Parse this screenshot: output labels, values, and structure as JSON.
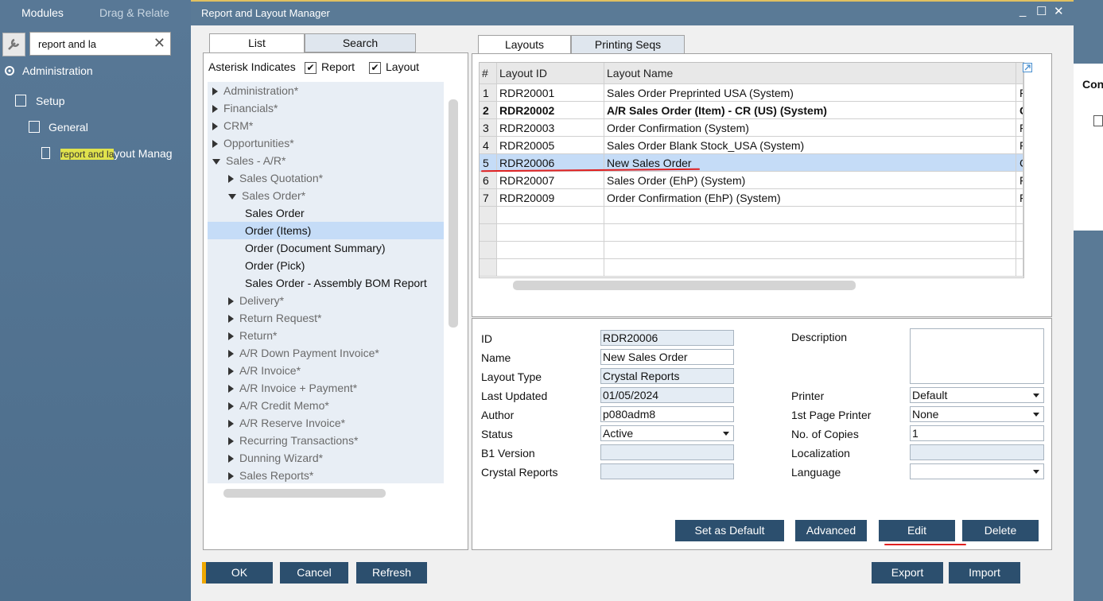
{
  "left_panel": {
    "tabs": [
      "Modules",
      "Drag & Relate"
    ],
    "search_value": "report and la",
    "tree": {
      "administration": "Administration",
      "setup": "Setup",
      "general": "General",
      "item_highlight": "report and la",
      "item_rest": "yout Manag"
    }
  },
  "right_strip": {
    "label": "Con"
  },
  "window": {
    "title": "Report and Layout Manager",
    "controls": [
      "_",
      "☐",
      "✕"
    ]
  },
  "left_tabs": {
    "list": "List",
    "search": "Search"
  },
  "asterisk": {
    "label": "Asterisk Indicates",
    "report": "Report",
    "layout": "Layout",
    "report_checked": true,
    "layout_checked": true
  },
  "tree_items": [
    {
      "label": "Administration*",
      "kind": "cat",
      "level": 0,
      "icon": "collapsed"
    },
    {
      "label": "Financials*",
      "kind": "cat",
      "level": 0,
      "icon": "collapsed"
    },
    {
      "label": "CRM*",
      "kind": "cat",
      "level": 0,
      "icon": "collapsed"
    },
    {
      "label": "Opportunities*",
      "kind": "cat",
      "level": 0,
      "icon": "collapsed"
    },
    {
      "label": "Sales - A/R*",
      "kind": "cat",
      "level": 0,
      "icon": "expanded"
    },
    {
      "label": "Sales Quotation*",
      "kind": "cat",
      "level": 1,
      "icon": "collapsed"
    },
    {
      "label": "Sales Order*",
      "kind": "cat",
      "level": 1,
      "icon": "expanded"
    },
    {
      "label": "Sales Order",
      "kind": "doc",
      "level": 2,
      "icon": "none"
    },
    {
      "label": "Order (Items)",
      "kind": "doc",
      "level": 2,
      "icon": "none",
      "selected": true
    },
    {
      "label": "Order (Document Summary)",
      "kind": "doc",
      "level": 2,
      "icon": "none"
    },
    {
      "label": "Order (Pick)",
      "kind": "doc",
      "level": 2,
      "icon": "none"
    },
    {
      "label": "Sales Order - Assembly BOM Report",
      "kind": "doc",
      "level": 2,
      "icon": "none"
    },
    {
      "label": "Delivery*",
      "kind": "cat",
      "level": 1,
      "icon": "collapsed"
    },
    {
      "label": "Return Request*",
      "kind": "cat",
      "level": 1,
      "icon": "collapsed"
    },
    {
      "label": "Return*",
      "kind": "cat",
      "level": 1,
      "icon": "collapsed"
    },
    {
      "label": "A/R Down Payment Invoice*",
      "kind": "cat",
      "level": 1,
      "icon": "collapsed"
    },
    {
      "label": "A/R Invoice*",
      "kind": "cat",
      "level": 1,
      "icon": "collapsed"
    },
    {
      "label": "A/R Invoice + Payment*",
      "kind": "cat",
      "level": 1,
      "icon": "collapsed"
    },
    {
      "label": "A/R Credit Memo*",
      "kind": "cat",
      "level": 1,
      "icon": "collapsed"
    },
    {
      "label": "A/R Reserve Invoice*",
      "kind": "cat",
      "level": 1,
      "icon": "collapsed"
    },
    {
      "label": "Recurring Transactions*",
      "kind": "cat",
      "level": 1,
      "icon": "collapsed"
    },
    {
      "label": "Dunning Wizard*",
      "kind": "cat",
      "level": 1,
      "icon": "collapsed"
    },
    {
      "label": "Sales Reports*",
      "kind": "cat",
      "level": 1,
      "icon": "collapsed"
    }
  ],
  "right_tabs": {
    "layouts": "Layouts",
    "printing": "Printing Seqs"
  },
  "grid": {
    "headers": [
      "#",
      "Layout ID",
      "Layout Name"
    ],
    "rows": [
      {
        "num": "1",
        "id": "RDR20001",
        "name": "Sales Order Preprinted USA (System)",
        "extra": "F"
      },
      {
        "num": "2",
        "id": "RDR20002",
        "name": "A/R Sales Order (Item) - CR (US) (System)",
        "extra": "C",
        "bold": true
      },
      {
        "num": "3",
        "id": "RDR20003",
        "name": "Order Confirmation (System)",
        "extra": "F"
      },
      {
        "num": "4",
        "id": "RDR20005",
        "name": "Sales Order Blank Stock_USA (System)",
        "extra": "F"
      },
      {
        "num": "5",
        "id": "RDR20006",
        "name": "New Sales Order",
        "extra": "C",
        "selected": true
      },
      {
        "num": "6",
        "id": "RDR20007",
        "name": "Sales Order (EhP) (System)",
        "extra": "F"
      },
      {
        "num": "7",
        "id": "RDR20009",
        "name": "Order Confirmation (EhP) (System)",
        "extra": "F"
      }
    ]
  },
  "form": {
    "id_label": "ID",
    "id_value": "RDR20006",
    "name_label": "Name",
    "name_value": "New Sales Order",
    "type_label": "Layout Type",
    "type_value": "Crystal Reports",
    "updated_label": "Last Updated",
    "updated_value": "01/05/2024",
    "author_label": "Author",
    "author_value": "p080adm8",
    "status_label": "Status",
    "status_value": "Active",
    "b1_label": "B1 Version",
    "b1_value": "",
    "crystal_label": "Crystal Reports",
    "crystal_value": "",
    "description_label": "Description",
    "description_value": "",
    "printer_label": "Printer",
    "printer_value": "Default",
    "first_printer_label": "1st Page Printer",
    "first_printer_value": "None",
    "copies_label": "No. of Copies",
    "copies_value": "1",
    "localization_label": "Localization",
    "localization_value": "",
    "language_label": "Language",
    "language_value": ""
  },
  "buttons": {
    "set_default": "Set as Default",
    "advanced": "Advanced",
    "edit": "Edit",
    "delete": "Delete",
    "ok": "OK",
    "cancel": "Cancel",
    "refresh": "Refresh",
    "export": "Export",
    "import": "Import"
  },
  "colors": {
    "button": "#2c4f6e",
    "selection": "#c5dcf7",
    "annotation": "#e02020",
    "highlight": "#e0e24c"
  }
}
